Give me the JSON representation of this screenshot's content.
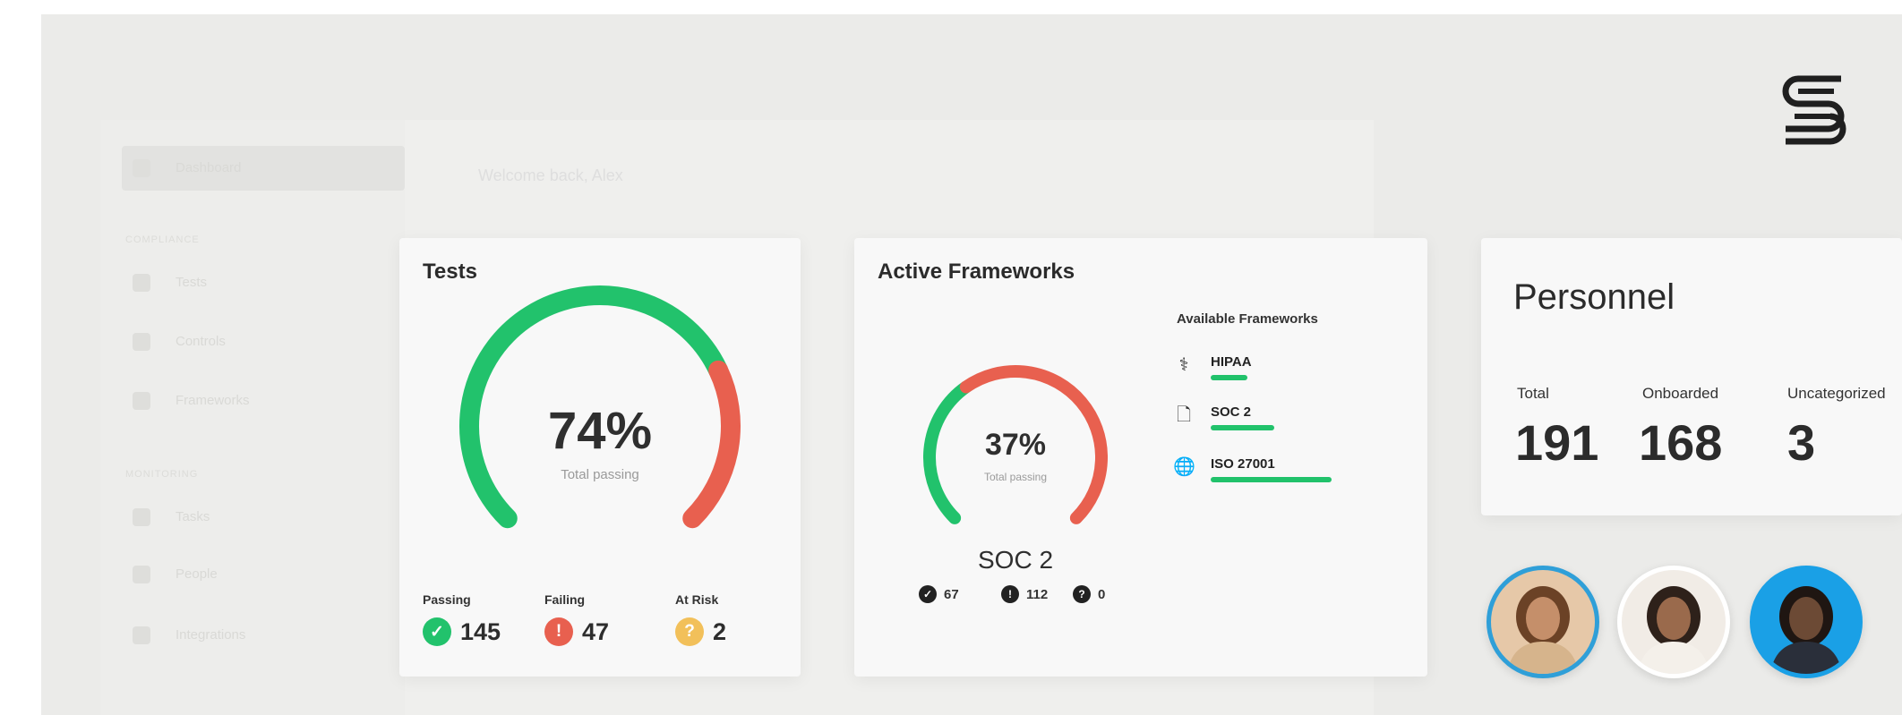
{
  "background": {
    "nav_active": "Dashboard",
    "welcome": "Welcome back, Alex",
    "sections": [
      "COMPLIANCE",
      "MONITORING"
    ],
    "nav_items": [
      "Tests",
      "Controls",
      "Frameworks",
      "Tasks",
      "People",
      "Integrations"
    ]
  },
  "tests": {
    "title": "Tests",
    "percent_text": "74%",
    "subtitle": "Total passing",
    "passing_fraction": 0.74,
    "colors": {
      "pass": "#22c26c",
      "fail": "#e8604f",
      "risk": "#f2c05a"
    },
    "stats": [
      {
        "label": "Passing",
        "value": "145",
        "icon": "check-icon",
        "glyph": "✓",
        "color": "#22c26c"
      },
      {
        "label": "Failing",
        "value": "47",
        "icon": "alert-icon",
        "glyph": "!",
        "color": "#e8604f"
      },
      {
        "label": "At Risk",
        "value": "2",
        "icon": "question-icon",
        "glyph": "?",
        "color": "#f2c05a"
      }
    ]
  },
  "frameworks": {
    "title": "Active Frameworks",
    "percent_text": "37%",
    "subtitle": "Total passing",
    "passing_fraction": 0.37,
    "framework_name": "SOC 2",
    "counts": [
      {
        "glyph": "✓",
        "value": "67",
        "icon": "check-icon"
      },
      {
        "glyph": "!",
        "value": "112",
        "icon": "alert-icon"
      },
      {
        "glyph": "?",
        "value": "0",
        "icon": "question-icon"
      }
    ],
    "available_title": "Available Frameworks",
    "available": [
      {
        "name": "HIPAA",
        "icon": "caduceus-icon",
        "glyph": "⚕",
        "progress": 0.27
      },
      {
        "name": "SOC 2",
        "icon": "document-icon",
        "glyph": "🗋",
        "progress": 0.47
      },
      {
        "name": "ISO 27001",
        "icon": "globe-icon",
        "glyph": "🌐",
        "progress": 0.9
      }
    ]
  },
  "personnel": {
    "title": "Personnel",
    "stats": [
      {
        "label": "Total",
        "value": "191"
      },
      {
        "label": "Onboarded",
        "value": "168"
      },
      {
        "label": "Uncategorized",
        "value": "3"
      }
    ]
  },
  "avatars": [
    {
      "name": "avatar-woman-glasses",
      "ring": "#2f9fd8",
      "bg": "#e6c8a8",
      "skin": "#c58f6a",
      "hair": "#6b4226",
      "shirt": "#d6b48c"
    },
    {
      "name": "avatar-woman-curly",
      "ring": "#ffffff",
      "bg": "#f1ece6",
      "skin": "#9a6a4c",
      "hair": "#2e211a",
      "shirt": "#f4f0ea"
    },
    {
      "name": "avatar-man-beard",
      "ring": "#1aa0e6",
      "bg": "#1aa0e6",
      "skin": "#6c4a35",
      "hair": "#1f1612",
      "shirt": "#2a2f3a"
    }
  ],
  "colors": {
    "green": "#22c26c",
    "red": "#e8604f",
    "amber": "#f2c05a"
  }
}
